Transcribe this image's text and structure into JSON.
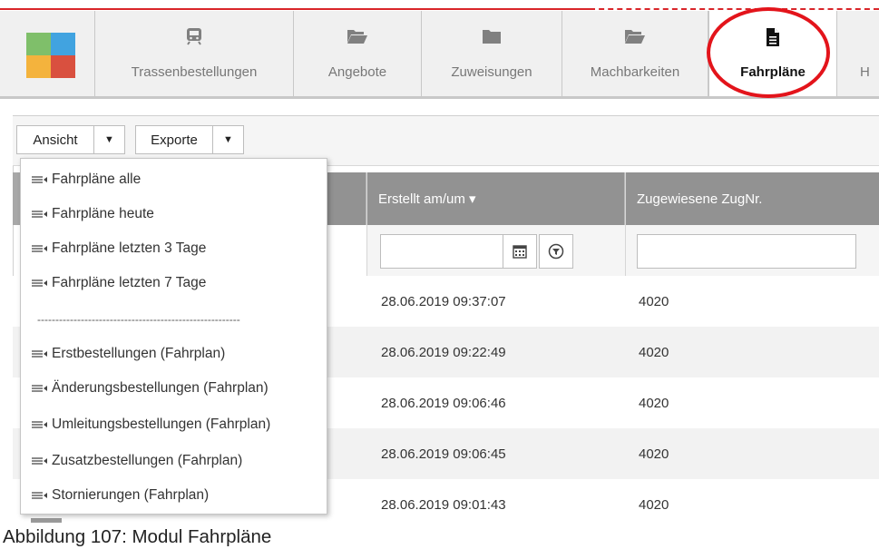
{
  "brand": {
    "colors": [
      "#7fbf6a",
      "#41a3e0",
      "#f4b33d",
      "#d9503f"
    ],
    "accent": "#d9262a",
    "highlight": "#e3141b"
  },
  "nav": {
    "items": [
      {
        "label": "Trassenbestellungen",
        "icon": "train-icon"
      },
      {
        "label": "Angebote",
        "icon": "folder-open-icon"
      },
      {
        "label": "Zuweisungen",
        "icon": "folder-icon"
      },
      {
        "label": "Machbarkeiten",
        "icon": "folder-open-icon"
      },
      {
        "label": "Fahrpläne",
        "icon": "document-icon",
        "active": true
      },
      {
        "label": "H",
        "icon": ""
      }
    ]
  },
  "toolbar": {
    "view_label": "Ansicht",
    "view_caret": "▼",
    "export_label": "Exporte",
    "export_caret": "▼"
  },
  "grid": {
    "columns": [
      {
        "label": "",
        "blank": true
      },
      {
        "label": "Erstellt am/um ▾"
      },
      {
        "label": "Zugewiesene ZugNr."
      }
    ],
    "rows": [
      {
        "created": "28.06.2019 09:37:07",
        "zugnr": "4020"
      },
      {
        "created": "28.06.2019 09:22:49",
        "zugnr": "4020"
      },
      {
        "created": "28.06.2019 09:06:46",
        "zugnr": "4020"
      },
      {
        "created": "28.06.2019 09:06:45",
        "zugnr": "4020"
      },
      {
        "created": "28.06.2019 09:01:43",
        "zugnr": "4020"
      }
    ]
  },
  "view_menu": {
    "items": [
      "Fahrpläne alle",
      "Fahrpläne heute",
      "Fahrpläne letzten 3 Tage",
      "Fahrpläne letzten 7 Tage"
    ],
    "separator": "--------------------------------------------------------",
    "items2": [
      "Erstbestellungen (Fahrplan)",
      "Änderungsbestellungen (Fahrplan)",
      "Umleitungsbestellungen (Fahrplan)",
      "Zusatzbestellungen (Fahrplan)",
      "Stornierungen (Fahrplan)"
    ]
  },
  "caption": "Abbildung 107: Modul Fahrpläne"
}
